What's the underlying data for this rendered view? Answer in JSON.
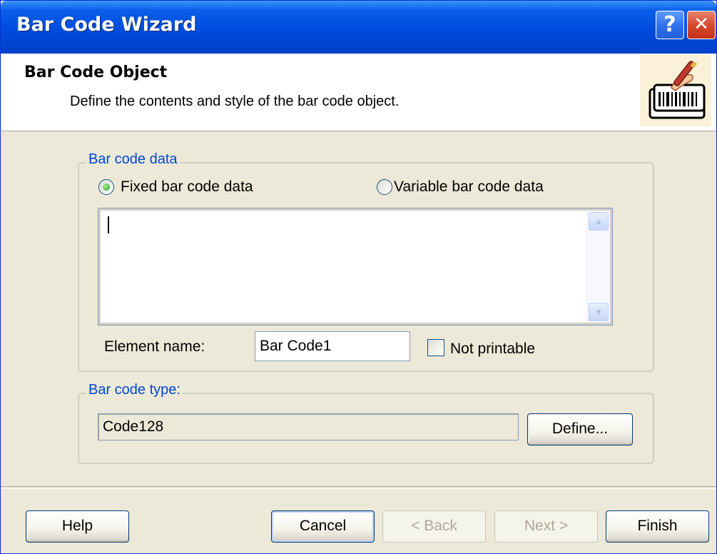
{
  "window": {
    "title": "Bar Code Wizard",
    "help_glyph": "?",
    "close_glyph": "✕"
  },
  "header": {
    "title": "Bar Code Object",
    "subtitle": "Define the contents and style of the bar code object.",
    "icon": "barcode-wizard-icon"
  },
  "bar_code_data": {
    "group_label": "Bar code data",
    "fixed_label": "Fixed bar code data",
    "variable_label": "Variable bar code data",
    "selected": "fixed",
    "data_value": "",
    "element_name_label": "Element name:",
    "element_name_value": "Bar Code1",
    "not_printable_label": "Not printable",
    "not_printable_checked": false
  },
  "bar_code_type": {
    "group_label": "Bar code type:",
    "value": "Code128",
    "define_label": "Define..."
  },
  "footer": {
    "help_label": "Help",
    "cancel_label": "Cancel",
    "back_label": "< Back",
    "next_label": "Next >",
    "finish_label": "Finish"
  },
  "colors": {
    "titlebar": "#0050E1",
    "group_label": "#0046D5",
    "face": "#ECE9D8"
  }
}
